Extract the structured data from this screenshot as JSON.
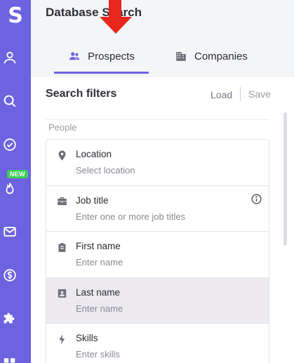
{
  "app": {
    "logo": "S",
    "badge_new": "NEW"
  },
  "header": {
    "title": "Database Search"
  },
  "tabs": [
    {
      "label": "Prospects",
      "icon": "people-icon",
      "active": true
    },
    {
      "label": "Companies",
      "icon": "building-icon",
      "active": false
    }
  ],
  "filters": {
    "title": "Search filters",
    "load_label": "Load",
    "save_label": "Save",
    "section_label": "People",
    "items": [
      {
        "label": "Location",
        "placeholder": "Select location",
        "icon": "location-pin-icon"
      },
      {
        "label": "Job title",
        "placeholder": "Enter one or more job titles",
        "icon": "briefcase-icon"
      },
      {
        "label": "First name",
        "placeholder": "Enter name",
        "icon": "clipboard-icon"
      },
      {
        "label": "Last name",
        "placeholder": "Enter name",
        "icon": "contact-card-icon"
      },
      {
        "label": "Skills",
        "placeholder": "Enter skills",
        "icon": "bolt-icon"
      }
    ]
  },
  "colors": {
    "accent": "#6c63e0",
    "badge": "#3fcf5b",
    "annotation_arrow": "#e8261c"
  }
}
